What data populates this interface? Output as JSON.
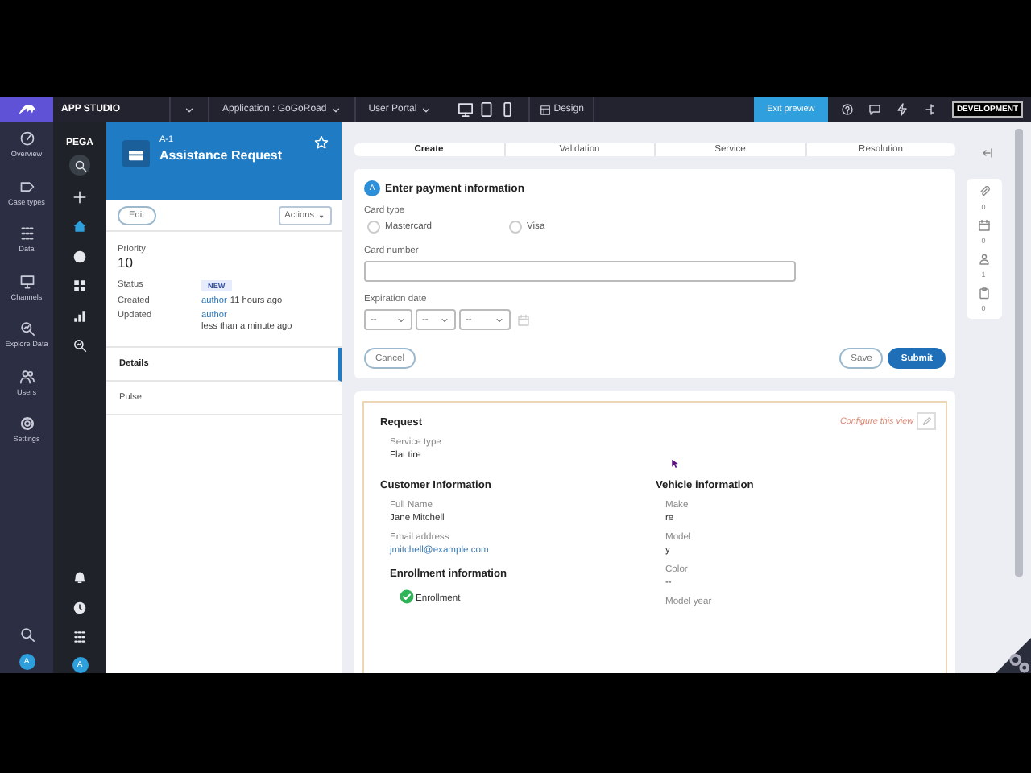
{
  "topbar": {
    "app_name": "APP STUDIO",
    "application": "Application : GoGoRoad",
    "portal": "User Portal",
    "devices": [
      {
        "kind": "desktop"
      },
      {
        "kind": "tablet"
      },
      {
        "kind": "phone"
      }
    ],
    "design": "Design",
    "exit_preview": "Exit preview",
    "tools": [
      {
        "kind": "help"
      },
      {
        "kind": "chat"
      },
      {
        "kind": "bolt"
      },
      {
        "kind": "tree"
      }
    ],
    "environment": "DEVELOPMENT"
  },
  "studio_nav": {
    "items": [
      {
        "kind": "gauge",
        "label": "Overview"
      },
      {
        "kind": "tag",
        "label": "Case types"
      },
      {
        "kind": "grid",
        "label": "Data"
      },
      {
        "kind": "monitor",
        "label": "Channels"
      },
      {
        "kind": "explore",
        "label": "Explore Data"
      },
      {
        "kind": "users",
        "label": "Users"
      },
      {
        "kind": "gear",
        "label": "Settings"
      }
    ],
    "avatar": "A"
  },
  "portal_nav": {
    "brand": "PEGA",
    "items": [
      {
        "kind": "search",
        "selected": false
      },
      {
        "kind": "plus",
        "selected": false
      },
      {
        "kind": "home",
        "selected": true
      },
      {
        "kind": "disc",
        "selected": false
      },
      {
        "kind": "tiles",
        "selected": false
      },
      {
        "kind": "bars",
        "selected": false
      },
      {
        "kind": "explore",
        "selected": false
      }
    ],
    "bottom_items": [
      {
        "kind": "bell"
      },
      {
        "kind": "clock"
      },
      {
        "kind": "apps"
      }
    ],
    "avatar": "A"
  },
  "case": {
    "id": "A-1",
    "title": "Assistance Request",
    "edit": "Edit",
    "actions": "Actions",
    "priority_label": "Priority",
    "priority": "10",
    "fields": [
      {
        "kind": "badge",
        "label": "Status",
        "value": "NEW"
      },
      {
        "kind": "author",
        "label": "Created",
        "author": "author",
        "value": "11 hours ago"
      },
      {
        "kind": "author",
        "label": "Updated",
        "author": "author",
        "value": "less than a minute ago"
      }
    ],
    "tabs": [
      {
        "label": "Details",
        "selected": true
      },
      {
        "label": "Pulse",
        "selected": false
      }
    ]
  },
  "stages": [
    {
      "label": "Create",
      "selected": true
    },
    {
      "label": "Validation",
      "selected": false
    },
    {
      "label": "Service",
      "selected": false
    },
    {
      "label": "Resolution",
      "selected": false
    }
  ],
  "assignment": {
    "badge": "A",
    "title": "Enter payment information",
    "card_type_label": "Card type",
    "card_types": [
      {
        "label": "Mastercard",
        "selected": false
      },
      {
        "label": "Visa",
        "selected": false
      }
    ],
    "card_number_label": "Card number",
    "expiration_label": "Expiration date",
    "date_parts": [
      "--",
      "--",
      "--"
    ],
    "cancel": "Cancel",
    "save": "Save",
    "submit": "Submit"
  },
  "review": {
    "configure": "Configure this view",
    "request": {
      "title": "Request",
      "fields": [
        {
          "kind": "text",
          "label": "Service type",
          "value": "Flat tire"
        }
      ]
    },
    "columns": [
      {
        "title": "Customer Information",
        "fields": [
          {
            "kind": "text",
            "label": "Full Name",
            "value": "Jane Mitchell"
          },
          {
            "kind": "link",
            "label": "Email address",
            "value": "jmitchell@example.com"
          }
        ],
        "subsection": {
          "title": "Enrollment information",
          "checks": [
            {
              "label": "Enrollment",
              "checked": true
            }
          ]
        }
      },
      {
        "title": "Vehicle information",
        "fields": [
          {
            "kind": "text",
            "label": "Make",
            "value": "re"
          },
          {
            "kind": "text",
            "label": "Model",
            "value": "y"
          },
          {
            "kind": "text",
            "label": "Color",
            "value": "--"
          },
          {
            "kind": "text",
            "label": "Model year"
          }
        ]
      }
    ]
  },
  "utilities": [
    {
      "kind": "paperclip",
      "count": "0"
    },
    {
      "kind": "calendar",
      "count": "0"
    },
    {
      "kind": "person",
      "count": "1"
    },
    {
      "kind": "clipboard",
      "count": "0"
    }
  ]
}
